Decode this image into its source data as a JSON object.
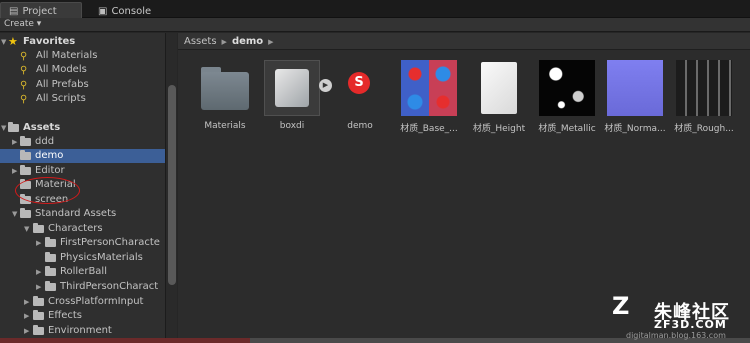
{
  "tabs": [
    {
      "label": "Project",
      "icon": "project-icon"
    },
    {
      "label": "Console",
      "icon": "console-icon"
    }
  ],
  "toolbar": {
    "create_label": "Create ▾"
  },
  "tree": {
    "favorites": {
      "label": "Favorites",
      "items": [
        "All Materials",
        "All Models",
        "All Prefabs",
        "All Scripts"
      ]
    },
    "assets": {
      "label": "Assets",
      "items": [
        "ddd",
        "demo",
        "Editor",
        "Material",
        "screen",
        "Standard Assets",
        "Characters",
        "FirstPersonCharacte",
        "PhysicsMaterials",
        "RollerBall",
        "ThirdPersonCharact",
        "CrossPlatformInput",
        "Effects",
        "Environment"
      ]
    }
  },
  "breadcrumb": {
    "root": "Assets",
    "current": "demo"
  },
  "assets_grid": [
    {
      "name": "Materials",
      "kind": "folder"
    },
    {
      "name": "boxdi",
      "kind": "model"
    },
    {
      "name": "demo",
      "kind": "substance"
    },
    {
      "name": "材质_Base_...",
      "kind": "texture"
    },
    {
      "name": "材质_Height",
      "kind": "texture"
    },
    {
      "name": "材质_Metallic",
      "kind": "texture"
    },
    {
      "name": "材质_Norma...",
      "kind": "texture"
    },
    {
      "name": "材质_Rough...",
      "kind": "texture"
    }
  ],
  "watermark": {
    "logo": "Z",
    "cn": "朱峰社区",
    "en": "ZF3D.COM",
    "url": "digitalman.blog.163.com"
  },
  "colors": {
    "selection": "#3c5f97",
    "annotation": "#d21b1b",
    "favorite_star": "#f1c40f"
  }
}
